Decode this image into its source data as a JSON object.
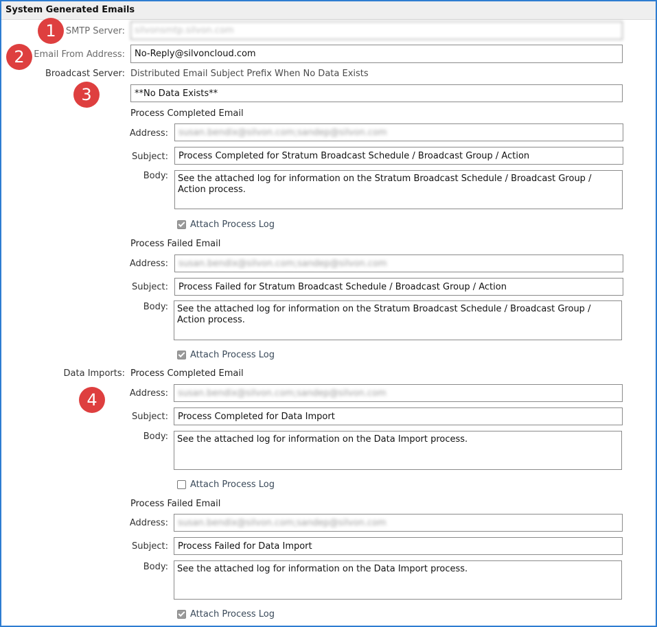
{
  "header": {
    "title": "System Generated Emails"
  },
  "smtp": {
    "label": "SMTP Server:",
    "value": "silvonsmtp.silvon.com"
  },
  "email_from": {
    "label": "Email From Address:",
    "value": "No-Reply@silvoncloud.com"
  },
  "broadcast": {
    "label": "Broadcast Server:",
    "prefix_label": "Distributed Email Subject Prefix When No Data Exists",
    "prefix_value": "**No Data Exists**",
    "completed": {
      "title": "Process Completed Email",
      "address_label": "Address:",
      "address_value": "susan.bendix@silvon.com;sandep@silvon.com",
      "subject_label": "Subject:",
      "subject_value": "Process Completed for Stratum Broadcast Schedule / Broadcast Group / Action",
      "body_label": "Body:",
      "body_value": "See the attached log for information on the Stratum Broadcast Schedule / Broadcast Group / Action process.",
      "attach_label": "Attach Process Log",
      "attach_checked": true
    },
    "failed": {
      "title": "Process Failed Email",
      "address_label": "Address:",
      "address_value": "susan.bendix@silvon.com;sandep@silvon.com",
      "subject_label": "Subject:",
      "subject_value": "Process Failed for Stratum Broadcast Schedule / Broadcast Group / Action",
      "body_label": "Body:",
      "body_value": "See the attached log for information on the Stratum Broadcast Schedule / Broadcast Group / Action process.",
      "attach_label": "Attach Process Log",
      "attach_checked": true
    }
  },
  "data_imports": {
    "label": "Data Imports:",
    "completed": {
      "title": "Process Completed Email",
      "address_label": "Address:",
      "address_value": "susan.bendix@silvon.com;sandep@silvon.com",
      "subject_label": "Subject:",
      "subject_value": "Process Completed for Data Import",
      "body_label": "Body:",
      "body_value": "See the attached log for information on the Data Import process.",
      "attach_label": "Attach Process Log",
      "attach_checked": false
    },
    "failed": {
      "title": "Process Failed Email",
      "address_label": "Address:",
      "address_value": "susan.bendix@silvon.com;sandep@silvon.com",
      "subject_label": "Subject:",
      "subject_value": "Process Failed for Data Import",
      "body_label": "Body:",
      "body_value": "See the attached log for information on the Data Import process.",
      "attach_label": "Attach Process Log",
      "attach_checked": true
    }
  },
  "badges": [
    "1",
    "2",
    "3",
    "4"
  ],
  "colors": {
    "badge": "#de3f3f",
    "frame_border": "#2e7dd1",
    "header_bg": "#efefef"
  }
}
